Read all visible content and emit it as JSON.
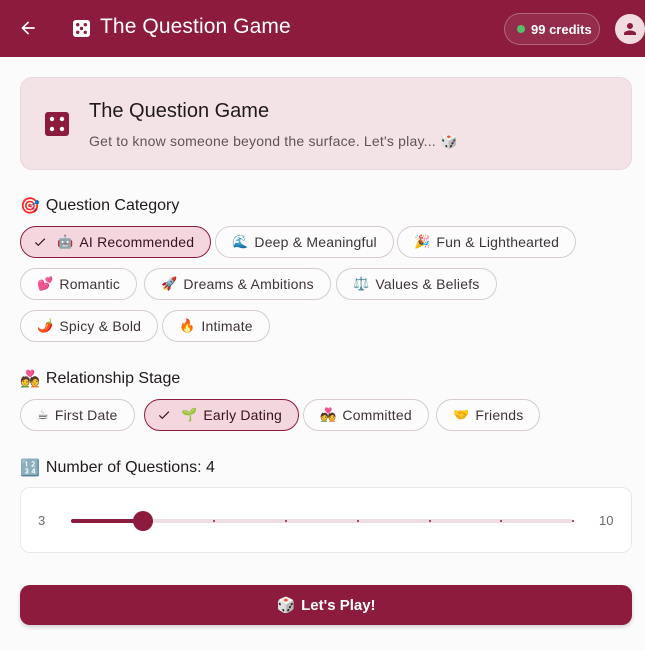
{
  "appbar": {
    "title": "The Question Game",
    "credits_label": "99 credits",
    "icons": {
      "back": "arrow-left-icon",
      "app": "dice-icon",
      "avatar": "person-icon"
    }
  },
  "hero": {
    "title": "The Question Game",
    "subtitle": "Get to know someone beyond the surface. Let's play... 🎲"
  },
  "category": {
    "emoji": "🎯",
    "title": "Question Category",
    "chips": [
      {
        "emoji": "🤖",
        "label": "AI Recommended",
        "selected": true
      },
      {
        "emoji": "🌊",
        "label": "Deep & Meaningful",
        "selected": false
      },
      {
        "emoji": "🎉",
        "label": "Fun & Lighthearted",
        "selected": false
      },
      {
        "emoji": "💕",
        "label": "Romantic",
        "selected": false
      },
      {
        "emoji": "🚀",
        "label": "Dreams & Ambitions",
        "selected": false
      },
      {
        "emoji": "⚖️",
        "label": "Values & Beliefs",
        "selected": false
      },
      {
        "emoji": "🌶️",
        "label": "Spicy & Bold",
        "selected": false
      },
      {
        "emoji": "🔥",
        "label": "Intimate",
        "selected": false
      }
    ]
  },
  "stage": {
    "emoji": "💑",
    "title": "Relationship Stage",
    "chips": [
      {
        "emoji": "☕",
        "label": "First Date",
        "selected": false
      },
      {
        "emoji": "🌱",
        "label": "Early Dating",
        "selected": true
      },
      {
        "emoji": "💑",
        "label": "Committed",
        "selected": false
      },
      {
        "emoji": "🤝",
        "label": "Friends",
        "selected": false
      }
    ]
  },
  "questions": {
    "emoji": "🔢",
    "title": "Number of Questions: 4",
    "min_label": "3",
    "max_label": "10",
    "min": 3,
    "max": 10,
    "value": 4
  },
  "play": {
    "emoji": "🎲",
    "label": "Let's Play!"
  },
  "colors": {
    "primary": "#8c1b3d",
    "hero_bg": "#f3e2e6",
    "chip_selected": "#f3d6de",
    "credits_dot": "#55c06a"
  }
}
